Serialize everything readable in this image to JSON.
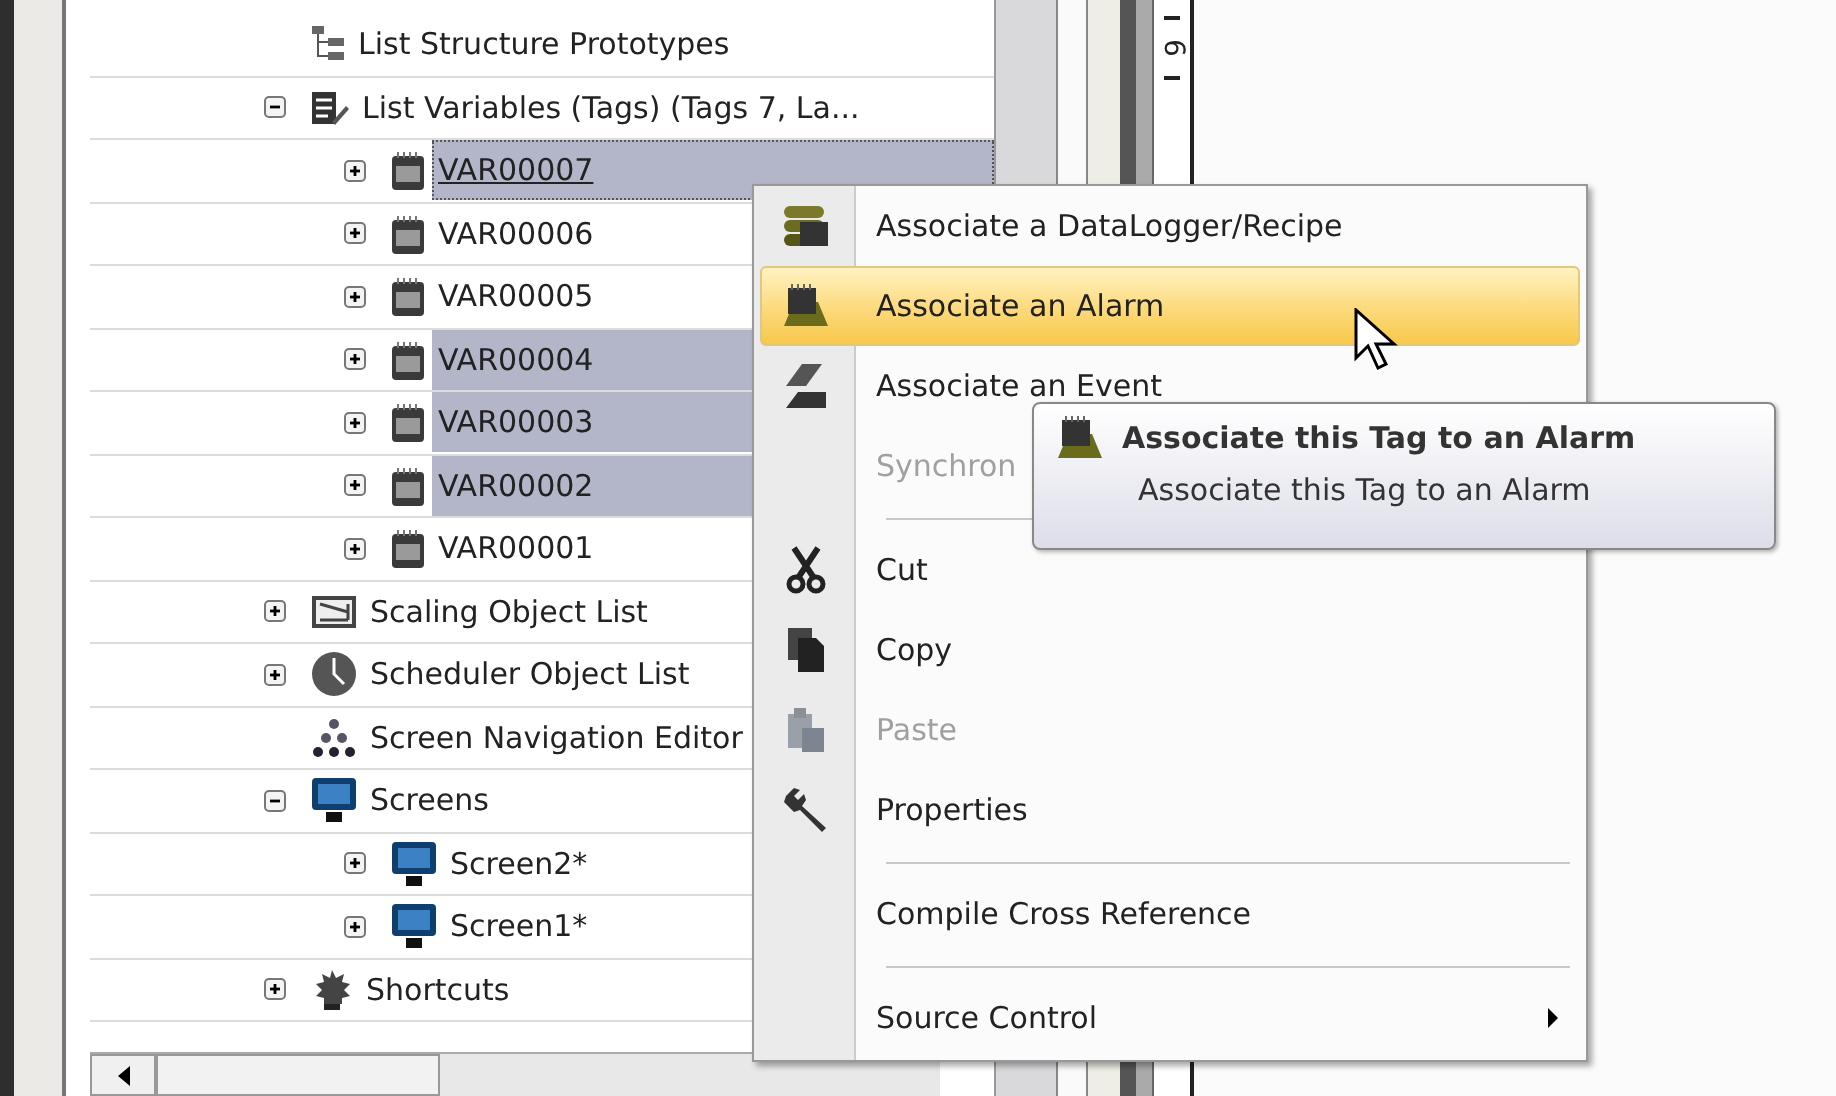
{
  "tree": {
    "items": [
      {
        "label": "List Structure Prototypes",
        "kind": "prototypes",
        "selected": false
      },
      {
        "label": "List Variables (Tags) (Tags 7, La...",
        "kind": "variables",
        "selected": false,
        "expanded": true,
        "children": [
          {
            "label": "VAR00007",
            "kind": "tag",
            "selected": true,
            "focused": true,
            "expanded": false
          },
          {
            "label": "VAR00006",
            "kind": "tag",
            "selected": false,
            "focused": false,
            "expanded": false
          },
          {
            "label": "VAR00005",
            "kind": "tag",
            "selected": false,
            "focused": false,
            "expanded": false
          },
          {
            "label": "VAR00004",
            "kind": "tag",
            "selected": true,
            "focused": false,
            "expanded": false
          },
          {
            "label": "VAR00003",
            "kind": "tag",
            "selected": true,
            "focused": false,
            "expanded": false
          },
          {
            "label": "VAR00002",
            "kind": "tag",
            "selected": true,
            "focused": false,
            "expanded": false
          },
          {
            "label": "VAR00001",
            "kind": "tag",
            "selected": false,
            "focused": false,
            "expanded": false
          }
        ]
      },
      {
        "label": "Scaling Object List",
        "kind": "scaling",
        "selected": false,
        "expanded": false
      },
      {
        "label": "Scheduler Object List",
        "kind": "scheduler",
        "selected": false,
        "expanded": false
      },
      {
        "label": "Screen Navigation Editor",
        "kind": "navigation",
        "selected": false
      },
      {
        "label": "Screens",
        "kind": "screens",
        "selected": false,
        "expanded": true,
        "children": [
          {
            "label": "Screen2*",
            "kind": "screen",
            "selected": false,
            "expanded": false
          },
          {
            "label": "Screen1*",
            "kind": "screen",
            "selected": false,
            "expanded": false
          }
        ]
      },
      {
        "label": "Shortcuts",
        "kind": "shortcuts",
        "selected": false,
        "expanded": false
      }
    ]
  },
  "ruler_label": "6",
  "context_menu": {
    "items": [
      {
        "label": "Associate a DataLogger/Recipe",
        "kind": "datalogger",
        "selected": false,
        "disabled": false
      },
      {
        "label": "Associate an Alarm",
        "kind": "alarm",
        "selected": true,
        "disabled": false
      },
      {
        "label": "Associate an Event",
        "kind": "event",
        "selected": false,
        "disabled": false
      },
      {
        "label": "Synchron",
        "kind": "none",
        "selected": false,
        "disabled": true
      },
      {
        "label": "Cut",
        "kind": "cut",
        "selected": false,
        "disabled": false,
        "separator_before": true
      },
      {
        "label": "Copy",
        "kind": "copy",
        "selected": false,
        "disabled": false
      },
      {
        "label": "Paste",
        "kind": "paste",
        "selected": false,
        "disabled": true
      },
      {
        "label": "Properties",
        "kind": "properties",
        "selected": false,
        "disabled": false
      },
      {
        "label": "Compile Cross Reference",
        "kind": "none",
        "selected": false,
        "disabled": false,
        "separator_before": true
      },
      {
        "label": "Source Control",
        "kind": "none",
        "selected": false,
        "disabled": false,
        "separator_before": true,
        "submenu": true
      }
    ]
  },
  "tooltip": {
    "title": "Associate this Tag to an Alarm",
    "text": "Associate this Tag to an Alarm"
  }
}
